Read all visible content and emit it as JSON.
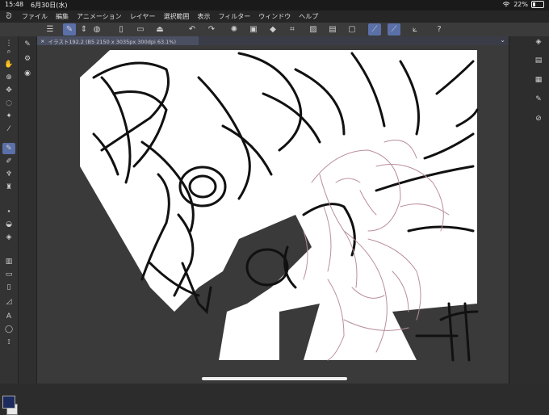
{
  "status": {
    "time": "15:48",
    "date": "6月30日(水)",
    "battery_pct": "22%",
    "battery_level": 0.22
  },
  "menu": {
    "logo": "clip-studio-logo",
    "items": [
      {
        "label": "ファイル"
      },
      {
        "label": "編集"
      },
      {
        "label": "アニメーション"
      },
      {
        "label": "レイヤー"
      },
      {
        "label": "選択範囲"
      },
      {
        "label": "表示"
      },
      {
        "label": "フィルター"
      },
      {
        "label": "ウィンドウ"
      },
      {
        "label": "ヘルプ"
      }
    ]
  },
  "document_tab": {
    "title": "イラスト192.2 (B5 2150 x 3035px 300dpi 63.1%)",
    "close": "×",
    "collapse": "⌄"
  },
  "colors": {
    "accent": "#5b6fa8",
    "main_color": "#1c2a5e",
    "sub_color": "#e8e8e8"
  }
}
